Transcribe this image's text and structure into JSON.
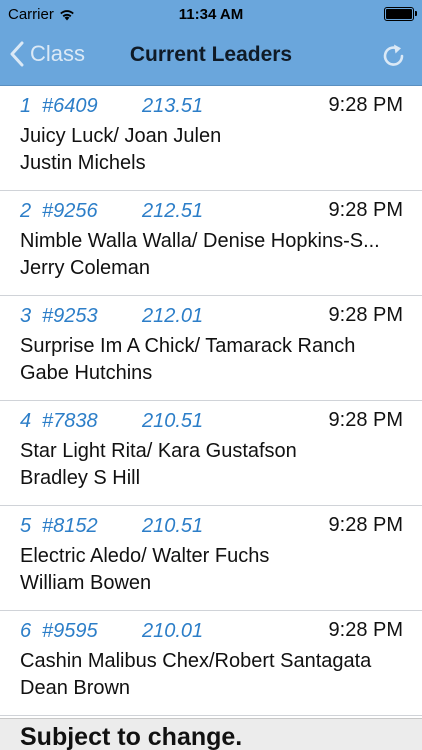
{
  "status": {
    "carrier": "Carrier",
    "time": "11:34 AM"
  },
  "nav": {
    "back_label": "Class",
    "title": "Current Leaders",
    "icons": {
      "back": "chevron-left-icon",
      "refresh": "refresh-icon"
    }
  },
  "colors": {
    "bar": "#6aa6dc",
    "accent_text": "#2c7ec8"
  },
  "leaders": [
    {
      "place": "1",
      "entry": "#6409",
      "score": "213.51",
      "time": "9:28 PM",
      "horse_owner": "Juicy Luck/ Joan Julen",
      "rider": "Justin Michels"
    },
    {
      "place": "2",
      "entry": "#9256",
      "score": "212.51",
      "time": "9:28 PM",
      "horse_owner": "Nimble Walla Walla/ Denise Hopkins-S...",
      "rider": "Jerry Coleman"
    },
    {
      "place": "3",
      "entry": "#9253",
      "score": "212.01",
      "time": "9:28 PM",
      "horse_owner": "Surprise Im A Chick/ Tamarack Ranch",
      "rider": "Gabe Hutchins"
    },
    {
      "place": "4",
      "entry": "#7838",
      "score": "210.51",
      "time": "9:28 PM",
      "horse_owner": "Star Light Rita/ Kara Gustafson",
      "rider": "Bradley S Hill"
    },
    {
      "place": "5",
      "entry": "#8152",
      "score": "210.51",
      "time": "9:28 PM",
      "horse_owner": "Electric Aledo/ Walter Fuchs",
      "rider": "William Bowen"
    },
    {
      "place": "6",
      "entry": "#9595",
      "score": "210.01",
      "time": "9:28 PM",
      "horse_owner": "Cashin Malibus Chex/Robert Santagata",
      "rider": "Dean Brown"
    }
  ],
  "footer": {
    "notice": "Subject to change."
  }
}
